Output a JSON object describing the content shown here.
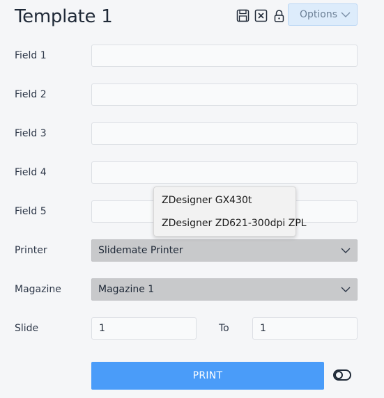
{
  "header": {
    "title": "Template 1",
    "options_label": "Options",
    "icons": [
      "save-icon",
      "close-icon",
      "lock-icon"
    ]
  },
  "form": {
    "fields": [
      {
        "label": "Field 1",
        "value": ""
      },
      {
        "label": "Field 2",
        "value": ""
      },
      {
        "label": "Field 3",
        "value": ""
      },
      {
        "label": "Field 4",
        "value": ""
      },
      {
        "label": "Field 5",
        "value": ""
      }
    ],
    "printer": {
      "label": "Printer",
      "selected": "Slidemate Printer"
    },
    "magazine": {
      "label": "Magazine",
      "selected": "Magazine 1"
    },
    "slide": {
      "label": "Slide",
      "from_value": "1",
      "to_label": "To",
      "to_value": "1"
    }
  },
  "printer_dropdown": {
    "options": [
      "ZDesigner GX430t",
      "ZDesigner ZD621-300dpi ZPL"
    ]
  },
  "actions": {
    "print_label": "PRINT"
  },
  "colors": {
    "print_button": "#4a9cf9",
    "options_button": "#ddecfb",
    "select_background": "#c8c9cb",
    "page_background": "#f5f6f8"
  }
}
